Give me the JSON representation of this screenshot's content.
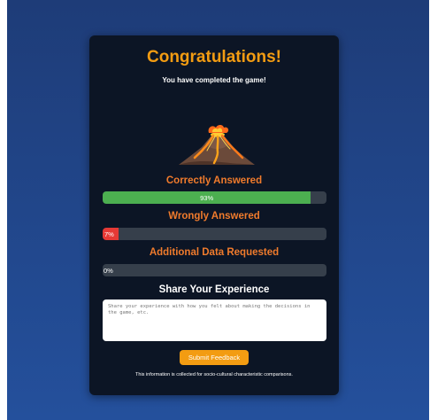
{
  "header": {
    "title": "Congratulations!",
    "subtitle": "You have completed the game!"
  },
  "illustration": {
    "icon": "volcano-icon"
  },
  "stats": {
    "correct": {
      "label": "Correctly Answered",
      "percent": 93,
      "percent_text": "93%",
      "color": "#4caf50"
    },
    "wrong": {
      "label": "Wrongly Answered",
      "percent": 7,
      "percent_text": "7%",
      "color": "#e53935"
    },
    "additional": {
      "label": "Additional Data Requested",
      "percent": 0,
      "percent_text": "0%",
      "color": "#4caf50"
    }
  },
  "feedback": {
    "title": "Share Your Experience",
    "placeholder": "Share your experience with how you felt about making the decisions in the game, etc.",
    "value": "",
    "submit_label": "Submit Feedback"
  },
  "footer": {
    "note": "This information is collected for socio-cultural characteristic comparisons."
  },
  "colors": {
    "accent": "#f39c12",
    "label_orange": "#f07b2c",
    "card_bg": "#0c1525",
    "bar_track": "#363f4b"
  }
}
